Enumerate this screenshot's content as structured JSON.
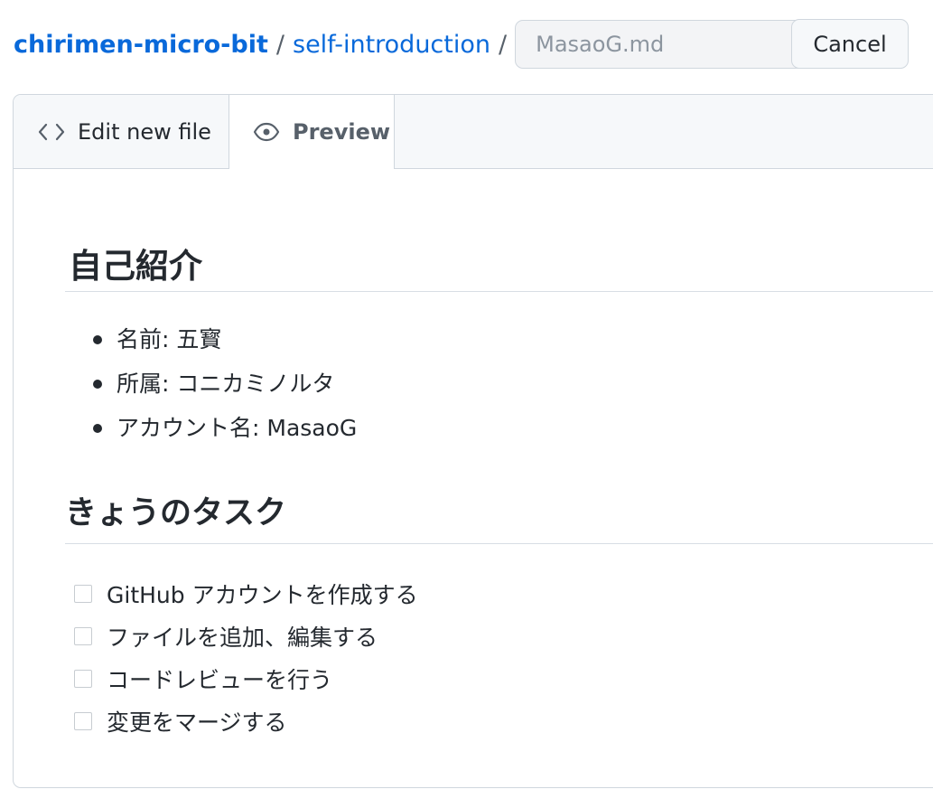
{
  "breadcrumb": {
    "repo": "chirimen-micro-bit",
    "folder": "self-introduction",
    "separator": "/"
  },
  "filename_input": {
    "value": "",
    "placeholder": "MasaoG.md"
  },
  "cancel_label": "Cancel",
  "tabs": {
    "edit": {
      "label": "Edit new file",
      "icon": "code-icon"
    },
    "preview": {
      "label": "Preview",
      "icon": "eye-icon",
      "active": true
    }
  },
  "preview": {
    "heading1": "自己紹介",
    "profile_items": [
      "名前: 五寳",
      "所属: コニカミノルタ",
      "アカウント名: MasaoG"
    ],
    "heading2": "きょうのタスク",
    "tasks": [
      {
        "label": "GitHub アカウントを作成する",
        "checked": false
      },
      {
        "label": "ファイルを追加、編集する",
        "checked": false
      },
      {
        "label": "コードレビューを行う",
        "checked": false
      },
      {
        "label": "変更をマージする",
        "checked": false
      }
    ]
  },
  "colors": {
    "link": "#0969da",
    "text": "#24292f",
    "border": "#d0d7de",
    "tabbar_bg": "#f6f8fa"
  }
}
